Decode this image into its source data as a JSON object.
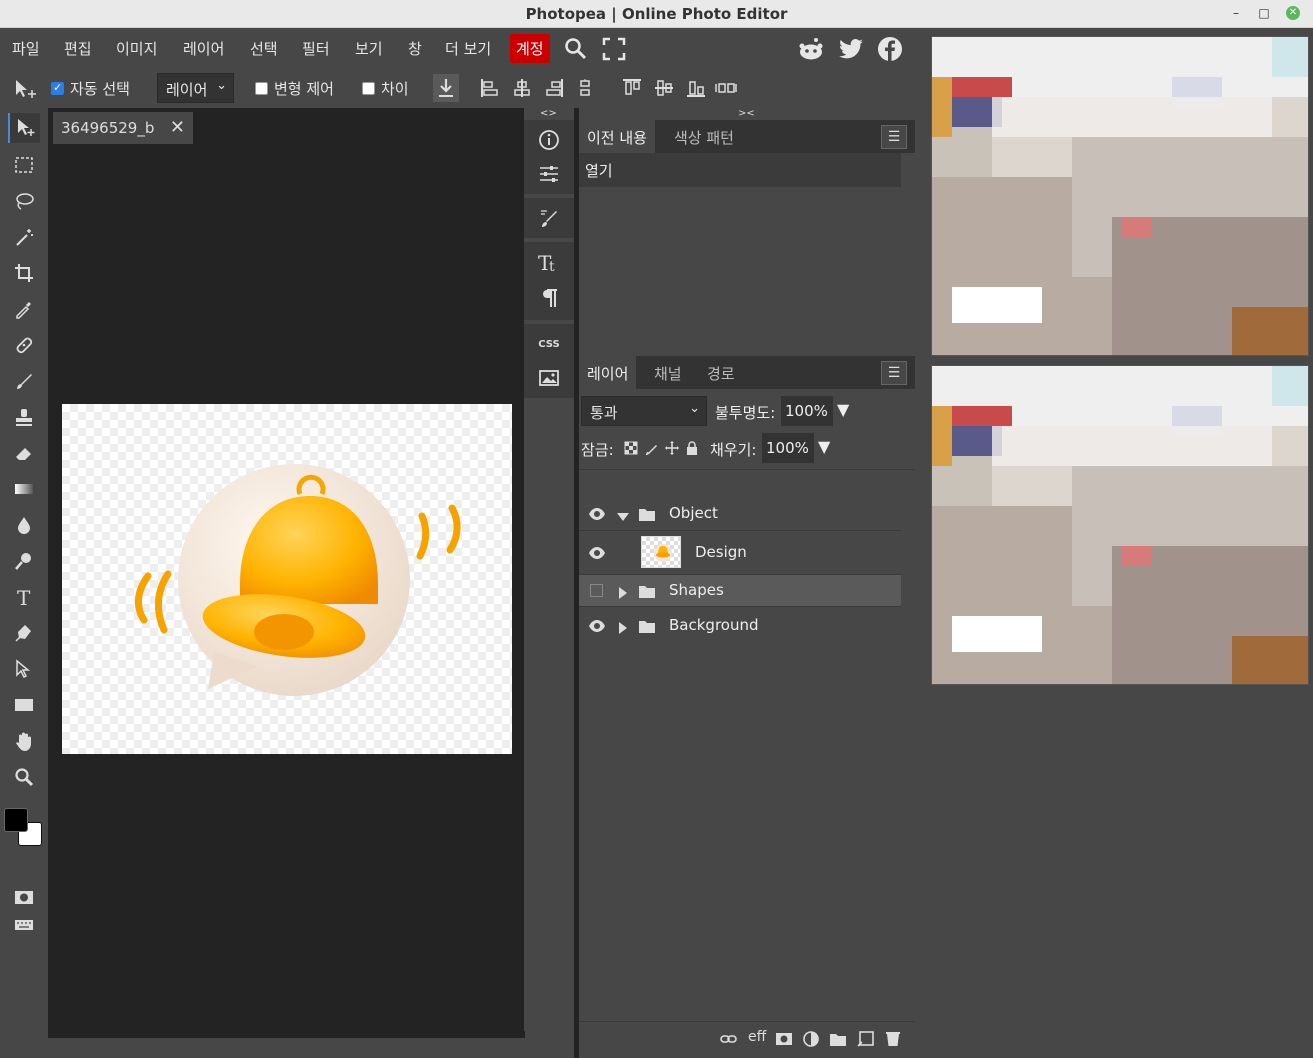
{
  "window": {
    "title": "Photopea | Online Photo Editor"
  },
  "menu": {
    "items": [
      "파일",
      "편집",
      "이미지",
      "레이어",
      "선택",
      "필터",
      "보기",
      "창",
      "더 보기"
    ],
    "account": "계정"
  },
  "options": {
    "auto_select_label": "자동 선택",
    "auto_select_checked": true,
    "target_dropdown": "레이어",
    "transform_controls_label": "변형 제어",
    "distances_label": "차이"
  },
  "document": {
    "tab_name": "36496529_b"
  },
  "history_panel": {
    "tabs": [
      "이전 내용",
      "색상 패턴"
    ],
    "items": [
      "열기"
    ]
  },
  "layers_panel": {
    "tabs": [
      "레이어",
      "채널",
      "경로"
    ],
    "blend_mode": "통과",
    "opacity_label": "불투명도:",
    "opacity_value": "100%",
    "lock_label": "잠금:",
    "fill_label": "채우기:",
    "fill_value": "100%",
    "layers": [
      {
        "name": "Object",
        "type": "group",
        "expanded": true,
        "visible": true
      },
      {
        "name": "Design",
        "type": "layer",
        "visible": true
      },
      {
        "name": "Shapes",
        "type": "group",
        "expanded": false,
        "visible": false,
        "selected": true
      },
      {
        "name": "Background",
        "type": "group",
        "expanded": false,
        "visible": true
      }
    ],
    "bottom_eff": "eff"
  },
  "side_strip": {
    "collapse_label": "<>",
    "expand_label": "><",
    "css_label": "CSS"
  },
  "colors": {
    "accent": "#2b7de9",
    "account_red": "#cc0000",
    "foreground": "#000000",
    "background": "#ffffff"
  }
}
